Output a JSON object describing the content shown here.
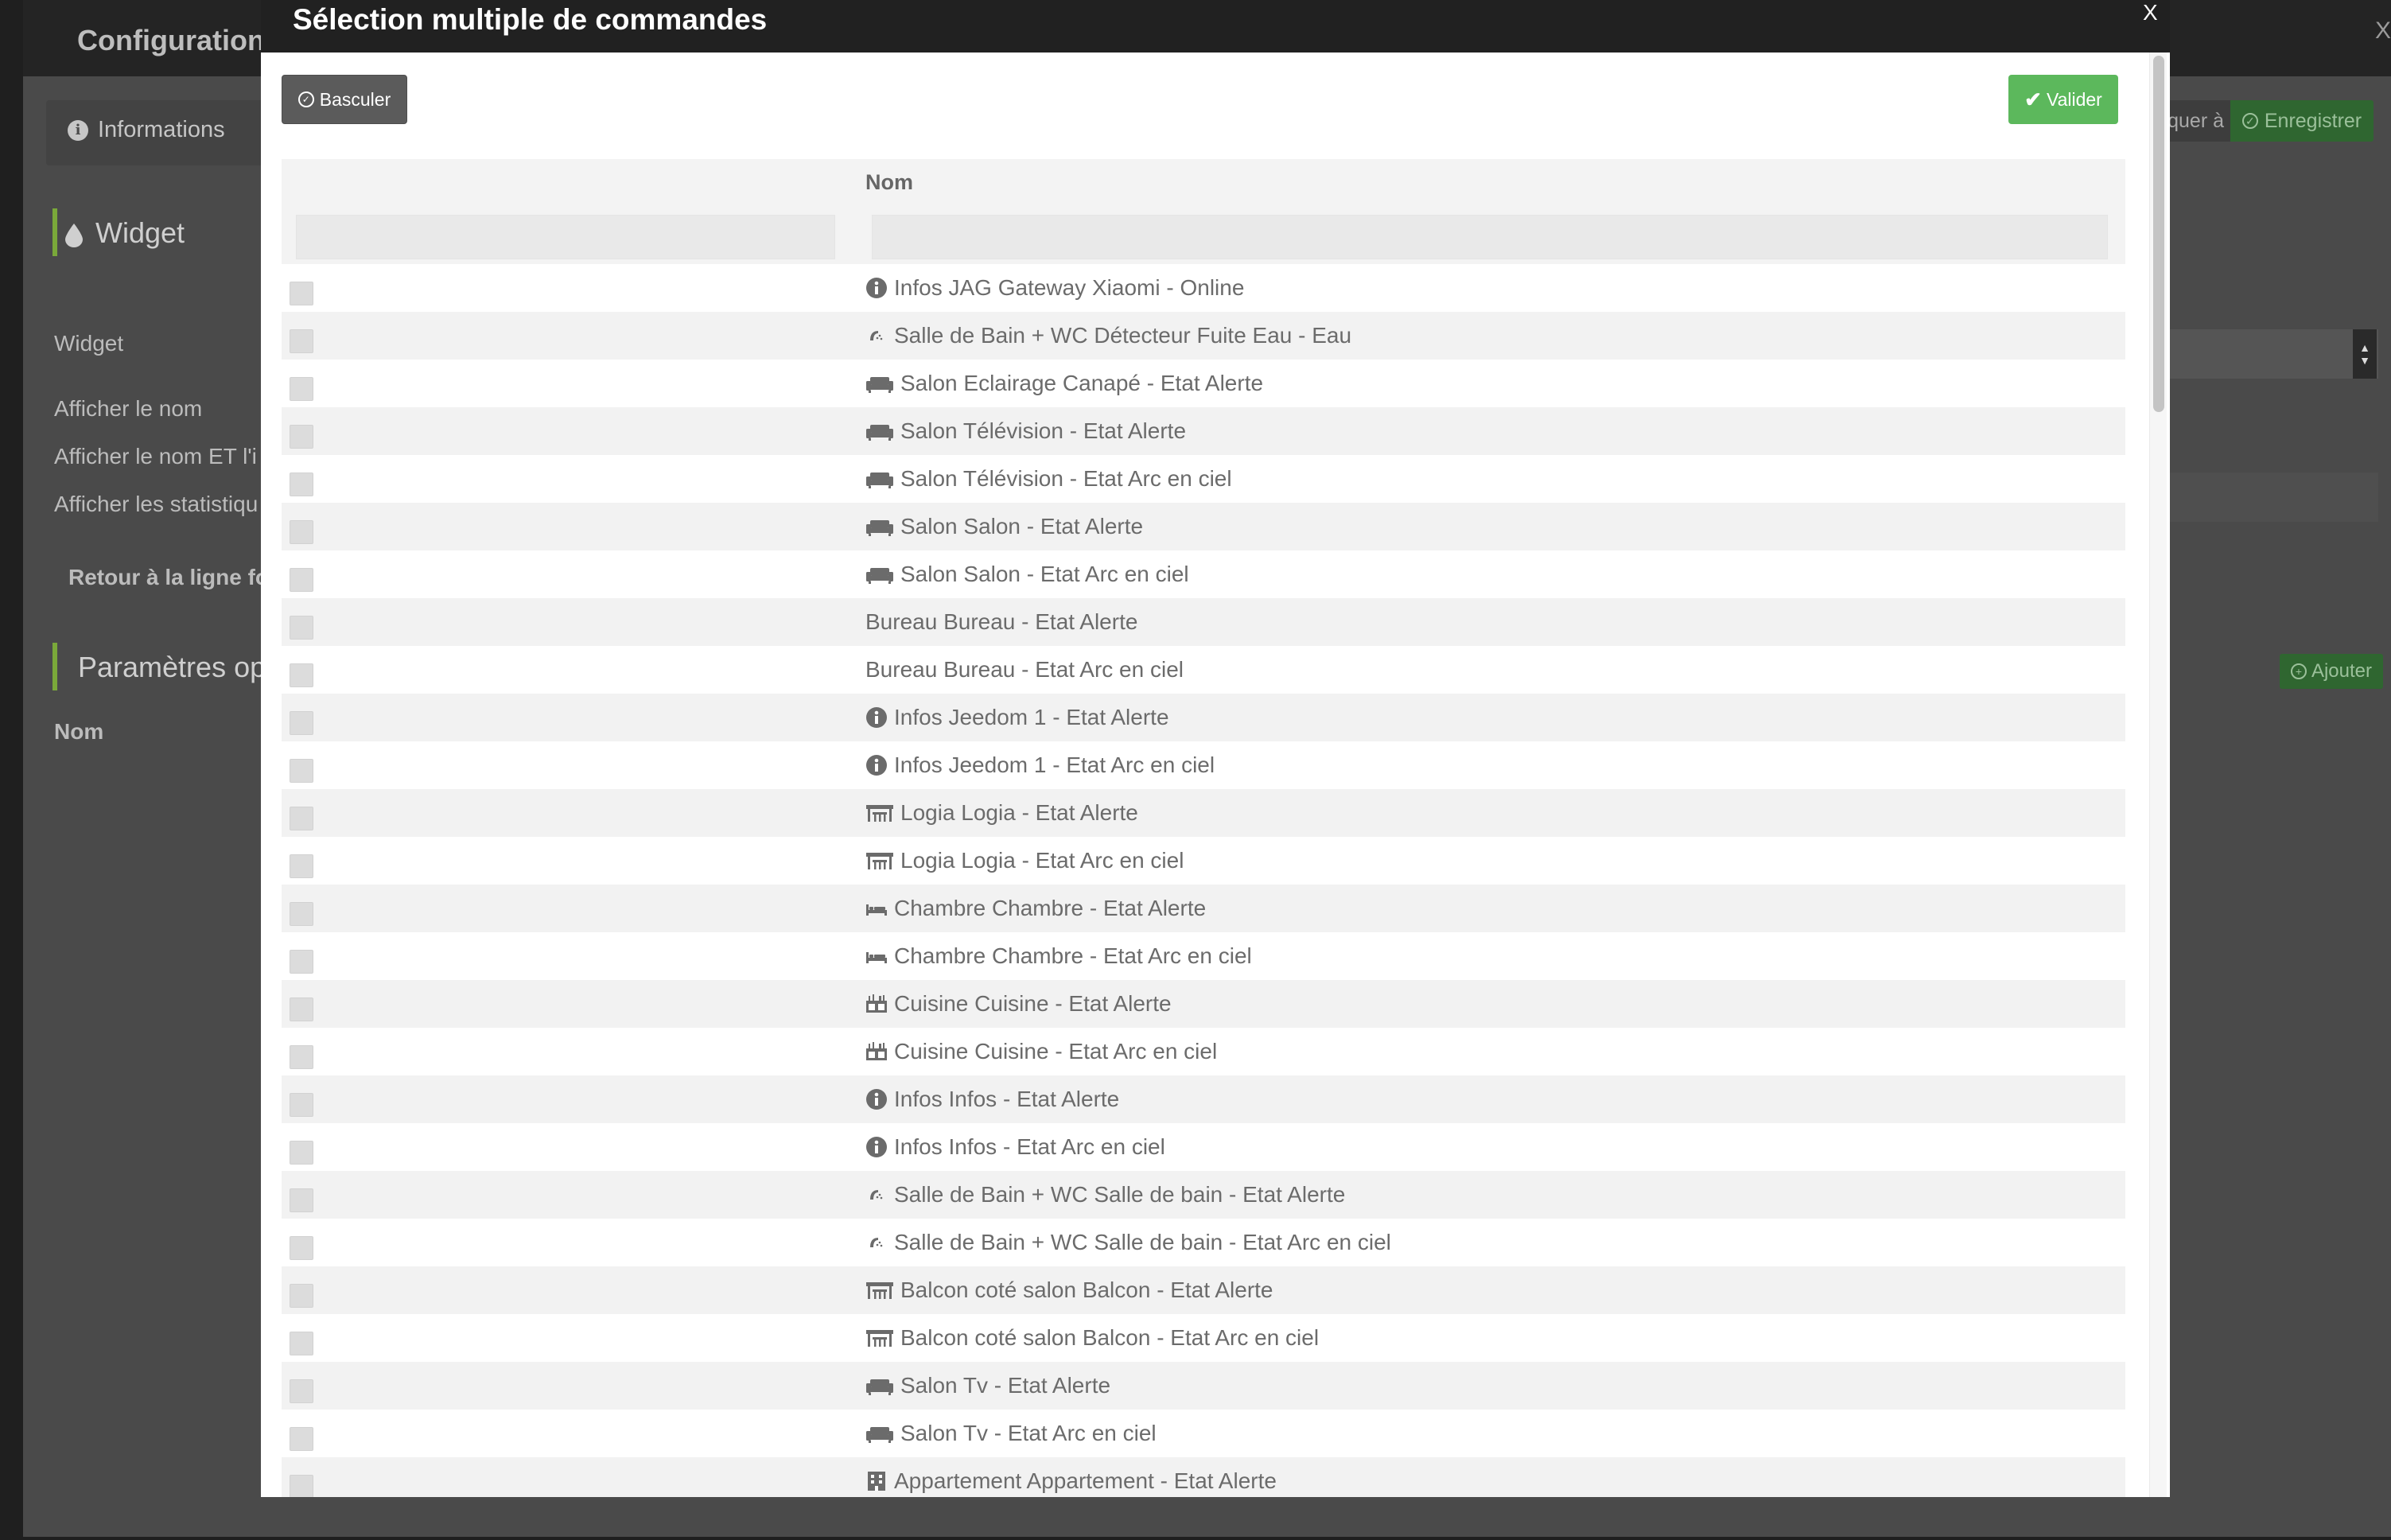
{
  "background": {
    "title": "Configuration co",
    "tabs": {
      "informations": "Informations"
    },
    "widget_section": "Widget",
    "labels": {
      "widget": "Widget",
      "afficher_nom": "Afficher le nom",
      "afficher_nom_et_icone": "Afficher le nom ET l'i",
      "afficher_stats": "Afficher les statistiqu",
      "retour_ligne": "Retour à la ligne for"
    },
    "params_section": "Paramètres opt",
    "name_col": "Nom",
    "buttons": {
      "appliquer": "quer à",
      "save": "Enregistrer",
      "add": "Ajouter"
    },
    "close": "X"
  },
  "modal": {
    "title": "Sélection multiple de commandes",
    "close": "X",
    "btn_toggle": "Basculer",
    "btn_validate": "Valider",
    "col_name": "Nom",
    "colors": {
      "header_bg": "#212121",
      "validate_bg": "#5cb85c",
      "toggle_bg": "#5b5b5b"
    },
    "rows": [
      {
        "icon": "info-icon",
        "label": "Infos JAG Gateway Xiaomi - Online"
      },
      {
        "icon": "shower-icon",
        "label": "Salle de Bain + WC Détecteur Fuite Eau - Eau"
      },
      {
        "icon": "sofa-icon",
        "label": "Salon Eclairage Canapé - Etat Alerte"
      },
      {
        "icon": "sofa-icon",
        "label": "Salon Télévision - Etat Alerte"
      },
      {
        "icon": "sofa-icon",
        "label": "Salon Télévision - Etat Arc en ciel"
      },
      {
        "icon": "sofa-icon",
        "label": "Salon Salon - Etat Alerte"
      },
      {
        "icon": "sofa-icon",
        "label": "Salon Salon - Etat Arc en ciel"
      },
      {
        "icon": "",
        "label": "Bureau Bureau - Etat Alerte"
      },
      {
        "icon": "",
        "label": "Bureau Bureau - Etat Arc en ciel"
      },
      {
        "icon": "info-icon",
        "label": "Infos Jeedom 1 - Etat Alerte"
      },
      {
        "icon": "info-icon",
        "label": "Infos Jeedom 1 - Etat Arc en ciel"
      },
      {
        "icon": "terrace-icon",
        "label": "Logia Logia - Etat Alerte"
      },
      {
        "icon": "terrace-icon",
        "label": "Logia Logia - Etat Arc en ciel"
      },
      {
        "icon": "bed-icon",
        "label": "Chambre Chambre - Etat Alerte"
      },
      {
        "icon": "bed-icon",
        "label": "Chambre Chambre - Etat Arc en ciel"
      },
      {
        "icon": "kitchen-icon",
        "label": "Cuisine Cuisine - Etat Alerte"
      },
      {
        "icon": "kitchen-icon",
        "label": "Cuisine Cuisine - Etat Arc en ciel"
      },
      {
        "icon": "info-icon",
        "label": "Infos Infos - Etat Alerte"
      },
      {
        "icon": "info-icon",
        "label": "Infos Infos - Etat Arc en ciel"
      },
      {
        "icon": "shower-icon",
        "label": "Salle de Bain + WC Salle de bain - Etat Alerte"
      },
      {
        "icon": "shower-icon",
        "label": "Salle de Bain + WC Salle de bain - Etat Arc en ciel"
      },
      {
        "icon": "terrace-icon",
        "label": "Balcon coté salon Balcon - Etat Alerte"
      },
      {
        "icon": "terrace-icon",
        "label": "Balcon coté salon Balcon - Etat Arc en ciel"
      },
      {
        "icon": "sofa-icon",
        "label": "Salon Tv - Etat Alerte"
      },
      {
        "icon": "sofa-icon",
        "label": "Salon Tv - Etat Arc en ciel"
      },
      {
        "icon": "building-icon",
        "label": "Appartement Appartement - Etat Alerte"
      }
    ]
  }
}
